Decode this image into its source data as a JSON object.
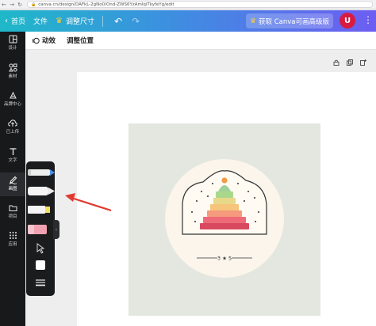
{
  "browser": {
    "back": "←",
    "forward": "→",
    "reload": "↻",
    "url": "canva.cn/design/DAFkL-2gNo0/Ond-ZWS6YzAmlqiTkyfeYg/edit"
  },
  "topbar": {
    "home_label": "首页",
    "file_label": "文件",
    "resize_label": "调整尺寸",
    "undo_icon": "↶",
    "redo_icon": "↷",
    "upgrade_label": "获取 Canva可画高级版",
    "avatar_letter": "U",
    "more_icon": "⋮"
  },
  "sidebar": {
    "items": [
      {
        "label": "设计",
        "icon": "design-grid-icon"
      },
      {
        "label": "素材",
        "icon": "elements-icon"
      },
      {
        "label": "品牌中心",
        "icon": "brand-icon"
      },
      {
        "label": "已上传",
        "icon": "upload-icon"
      },
      {
        "label": "文字",
        "icon": "text-icon"
      },
      {
        "label": "画图",
        "icon": "draw-icon"
      },
      {
        "label": "项目",
        "icon": "folder-icon"
      },
      {
        "label": "应用",
        "icon": "apps-icon"
      }
    ],
    "active_index": 5
  },
  "toolstrip": {
    "animate_label": "动效",
    "position_label": "调整位置"
  },
  "artwork": {
    "caption": "3 ★ 5"
  },
  "colors": {
    "accent_gradient_start": "#1fb8c9",
    "accent_gradient_end": "#6d5df2",
    "avatar": "#d81b40",
    "sidebar_bg": "#18191b",
    "artboard_bg": "#e4e7df",
    "arrow": "#e03a2f"
  }
}
